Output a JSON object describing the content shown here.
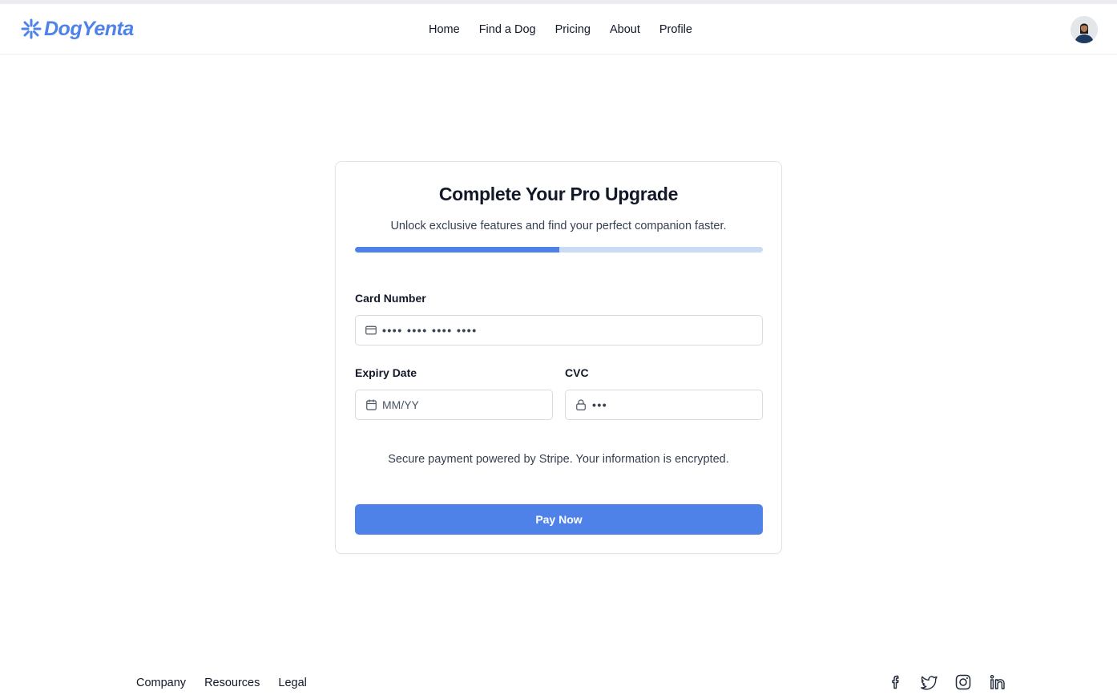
{
  "header": {
    "logo_text": "DogYenta",
    "nav": [
      {
        "label": "Home"
      },
      {
        "label": "Find a Dog"
      },
      {
        "label": "Pricing"
      },
      {
        "label": "About"
      },
      {
        "label": "Profile"
      }
    ],
    "avatar_icon": "user-avatar"
  },
  "card": {
    "title": "Complete Your Pro Upgrade",
    "subtitle": "Unlock exclusive features and find your perfect companion faster.",
    "progress_fraction": 0.5,
    "card_number": {
      "label": "Card Number",
      "value": "•••• •••• •••• ••••",
      "icon": "credit-card-icon"
    },
    "expiry": {
      "label": "Expiry Date",
      "placeholder": "MM/YY",
      "icon": "calendar-icon"
    },
    "cvc": {
      "label": "CVC",
      "value": "•••",
      "icon": "lock-icon"
    },
    "secure_note": "Secure payment powered by Stripe. Your information is encrypted.",
    "pay_button": "Pay Now"
  },
  "footer": {
    "links": [
      {
        "label": "Company"
      },
      {
        "label": "Resources"
      },
      {
        "label": "Legal"
      }
    ],
    "social_icons": [
      "facebook-icon",
      "twitter-icon",
      "instagram-icon",
      "linkedin-icon"
    ]
  },
  "colors": {
    "accent": "#4f82e8",
    "progress_track": "#c9dbf7",
    "border": "#d8dbe0",
    "text": "#111827",
    "muted_text": "#374151"
  }
}
